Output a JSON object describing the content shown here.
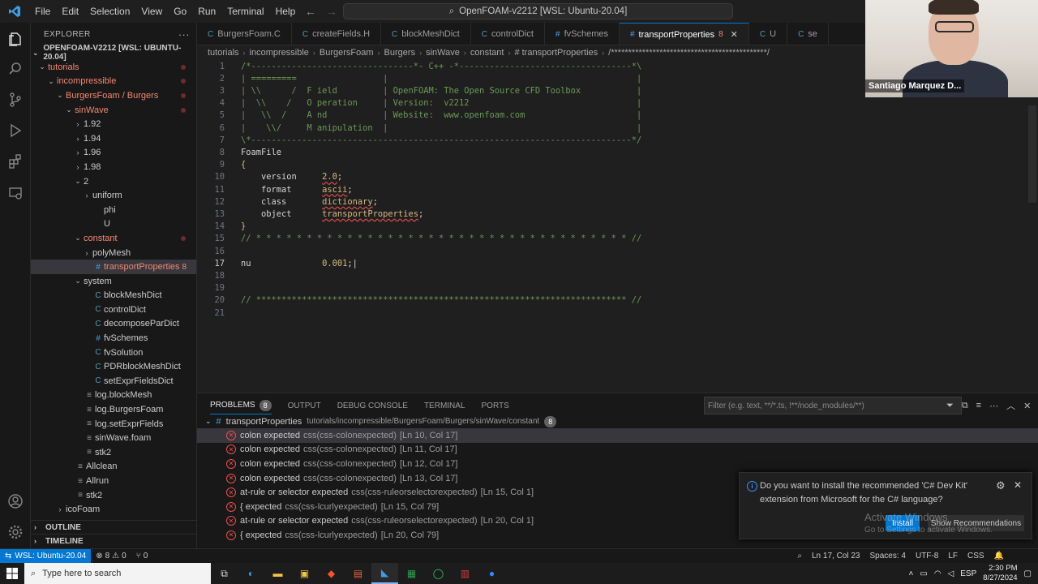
{
  "titlebar": {
    "menu": [
      "File",
      "Edit",
      "Selection",
      "View",
      "Go",
      "Run",
      "Terminal",
      "Help"
    ],
    "command_center": "OpenFOAM-v2212 [WSL: Ubuntu-20.04]"
  },
  "sidebar": {
    "header": "EXPLORER",
    "root": "OPENFOAM-V2212 [WSL: UBUNTU-20.04]",
    "tree": [
      {
        "label": "tutorials",
        "indent": 1,
        "kind": "folder-open",
        "red": true,
        "dot": true
      },
      {
        "label": "incompressible",
        "indent": 2,
        "kind": "folder-open",
        "red": true,
        "dot": true
      },
      {
        "label": "BurgersFoam / Burgers",
        "indent": 3,
        "kind": "folder-open",
        "red": true,
        "dot": true
      },
      {
        "label": "sinWave",
        "indent": 4,
        "kind": "folder-open",
        "red": true,
        "dot": true
      },
      {
        "label": "1.92",
        "indent": 5,
        "kind": "folder"
      },
      {
        "label": "1.94",
        "indent": 5,
        "kind": "folder"
      },
      {
        "label": "1.96",
        "indent": 5,
        "kind": "folder"
      },
      {
        "label": "1.98",
        "indent": 5,
        "kind": "folder"
      },
      {
        "label": "2",
        "indent": 5,
        "kind": "folder-open"
      },
      {
        "label": "uniform",
        "indent": 6,
        "kind": "folder"
      },
      {
        "label": "phi",
        "indent": 6,
        "kind": "file"
      },
      {
        "label": "U",
        "indent": 6,
        "kind": "file"
      },
      {
        "label": "constant",
        "indent": 5,
        "kind": "folder-open",
        "red": true,
        "dot": true
      },
      {
        "label": "polyMesh",
        "indent": 6,
        "kind": "folder"
      },
      {
        "label": "transportProperties",
        "indent": 6,
        "kind": "hash",
        "red": true,
        "badge": "8",
        "selected": true
      },
      {
        "label": "system",
        "indent": 5,
        "kind": "folder-open"
      },
      {
        "label": "blockMeshDict",
        "indent": 6,
        "kind": "c"
      },
      {
        "label": "controlDict",
        "indent": 6,
        "kind": "c"
      },
      {
        "label": "decomposeParDict",
        "indent": 6,
        "kind": "c"
      },
      {
        "label": "fvSchemes",
        "indent": 6,
        "kind": "hash"
      },
      {
        "label": "fvSolution",
        "indent": 6,
        "kind": "c"
      },
      {
        "label": "PDRblockMeshDict",
        "indent": 6,
        "kind": "c"
      },
      {
        "label": "setExprFieldsDict",
        "indent": 6,
        "kind": "c"
      },
      {
        "label": "log.blockMesh",
        "indent": 5,
        "kind": "lines"
      },
      {
        "label": "log.BurgersFoam",
        "indent": 5,
        "kind": "lines"
      },
      {
        "label": "log.setExprFields",
        "indent": 5,
        "kind": "lines"
      },
      {
        "label": "sinWave.foam",
        "indent": 5,
        "kind": "lines"
      },
      {
        "label": "stk2",
        "indent": 5,
        "kind": "lines"
      },
      {
        "label": "Allclean",
        "indent": 4,
        "kind": "lines"
      },
      {
        "label": "Allrun",
        "indent": 4,
        "kind": "lines"
      },
      {
        "label": "stk2",
        "indent": 4,
        "kind": "lines"
      },
      {
        "label": "icoFoam",
        "indent": 3,
        "kind": "folder"
      }
    ],
    "outline": "OUTLINE",
    "timeline": "TIMELINE"
  },
  "tabs": [
    {
      "label": "BurgersFoam.C",
      "icon": "C"
    },
    {
      "label": "createFields.H",
      "icon": "C"
    },
    {
      "label": "blockMeshDict",
      "icon": "C"
    },
    {
      "label": "controlDict",
      "icon": "C"
    },
    {
      "label": "fvSchemes",
      "icon": "#"
    },
    {
      "label": "transportProperties",
      "icon": "#",
      "badge": "8",
      "active": true
    },
    {
      "label": "U",
      "icon": "C"
    },
    {
      "label": "se",
      "icon": "C"
    }
  ],
  "breadcrumb": [
    "tutorials",
    "incompressible",
    "BurgersFoam",
    "Burgers",
    "sinWave",
    "constant",
    "# transportProperties",
    "/*********************************************/"
  ],
  "editor": {
    "lines": [
      {
        "n": "1",
        "html": "<span class='c-comment'>/*--------------------------------*- C++ -*----------------------------------*\\</span>"
      },
      {
        "n": "2",
        "html": "<span class='c-comment'>| =========                 |                                                 |</span>"
      },
      {
        "n": "3",
        "html": "<span class='c-comment'>| \\\\      /  F ield         | OpenFOAM: The Open Source CFD Toolbox           |</span>"
      },
      {
        "n": "4",
        "html": "<span class='c-comment'>|  \\\\    /   O peration     | Version:  v2212                                 |</span>"
      },
      {
        "n": "5",
        "html": "<span class='c-comment'>|   \\\\  /    A nd           | Website:  www.openfoam.com                      |</span>"
      },
      {
        "n": "6",
        "html": "<span class='c-comment'>|    \\\\/     M anipulation  |                                                 |</span>"
      },
      {
        "n": "7",
        "html": "<span class='c-comment'>\\*---------------------------------------------------------------------------*/</span>"
      },
      {
        "n": "8",
        "html": "<span class='c-plain'>FoamFile</span>"
      },
      {
        "n": "9",
        "html": "<span class='c-val'>{</span>"
      },
      {
        "n": "10",
        "html": "<span class='c-plain'>    version     </span><span class='c-val c-squig'>2.0</span><span class='c-plain'>;</span>"
      },
      {
        "n": "11",
        "html": "<span class='c-plain'>    format      </span><span class='c-val c-squig'>ascii</span><span class='c-plain'>;</span>"
      },
      {
        "n": "12",
        "html": "<span class='c-plain'>    class       </span><span class='c-val c-squig'>dictionary</span><span class='c-plain'>;</span>"
      },
      {
        "n": "13",
        "html": "<span class='c-plain'>    object      </span><span class='c-val c-squig'>transportProperties</span><span class='c-plain'>;</span>"
      },
      {
        "n": "14",
        "html": "<span class='c-val'>}</span>"
      },
      {
        "n": "15",
        "html": "<span class='c-comment'>// * * * * * * * * * * * * * * * * * * * * * * * * * * * * * * * * * * * * * //</span>"
      },
      {
        "n": "16",
        "html": ""
      },
      {
        "n": "17",
        "html": "<span class='c-plain'>nu              </span><span class='c-val'>0.001</span><span class='c-plain'>;|</span>",
        "current": true
      },
      {
        "n": "18",
        "html": ""
      },
      {
        "n": "19",
        "html": ""
      },
      {
        "n": "20",
        "html": "<span class='c-comment'>// ************************************************************************* //</span>"
      },
      {
        "n": "21",
        "html": ""
      }
    ]
  },
  "panel": {
    "tabs": [
      {
        "label": "PROBLEMS",
        "count": "8",
        "active": true
      },
      {
        "label": "OUTPUT"
      },
      {
        "label": "DEBUG CONSOLE"
      },
      {
        "label": "TERMINAL"
      },
      {
        "label": "PORTS"
      }
    ],
    "filter_placeholder": "Filter (e.g. text, **/*.ts, !**/node_modules/**)",
    "group": {
      "file": "transportProperties",
      "path": "tutorials/incompressible/BurgersFoam/Burgers/sinWave/constant",
      "count": "8"
    },
    "problems": [
      {
        "msg": "colon expected",
        "src": "css(css-colonexpected)",
        "loc": "[Ln 10, Col 17]"
      },
      {
        "msg": "colon expected",
        "src": "css(css-colonexpected)",
        "loc": "[Ln 11, Col 17]"
      },
      {
        "msg": "colon expected",
        "src": "css(css-colonexpected)",
        "loc": "[Ln 12, Col 17]"
      },
      {
        "msg": "colon expected",
        "src": "css(css-colonexpected)",
        "loc": "[Ln 13, Col 17]"
      },
      {
        "msg": "at-rule or selector expected",
        "src": "css(css-ruleorselectorexpected)",
        "loc": "[Ln 15, Col 1]"
      },
      {
        "msg": "{ expected",
        "src": "css(css-lcurlyexpected)",
        "loc": "[Ln 15, Col 79]"
      },
      {
        "msg": "at-rule or selector expected",
        "src": "css(css-ruleorselectorexpected)",
        "loc": "[Ln 20, Col 1]"
      },
      {
        "msg": "{ expected",
        "src": "css(css-lcurlyexpected)",
        "loc": "[Ln 20, Col 79]"
      }
    ]
  },
  "notification": {
    "message": "Do you want to install the recommended 'C# Dev Kit' extension from Microsoft for the C# language?",
    "install": "Install",
    "show_recommendations": "Show Recommendations"
  },
  "watermark": {
    "line1": "Activate Windows",
    "line2": "Go to Settings to activate Windows."
  },
  "statusbar": {
    "remote": "WSL: Ubuntu-20.04",
    "errors": "8",
    "warnings": "0",
    "ports": "0",
    "position": "Ln 17, Col 23",
    "spaces": "Spaces: 4",
    "encoding": "UTF-8",
    "eol": "LF",
    "language": "CSS"
  },
  "taskbar": {
    "search_placeholder": "Type here to search",
    "lang": "ESP",
    "time": "2:30 PM",
    "date": "8/27/2024"
  },
  "webcam": {
    "name": "Santiago Marquez D..."
  }
}
